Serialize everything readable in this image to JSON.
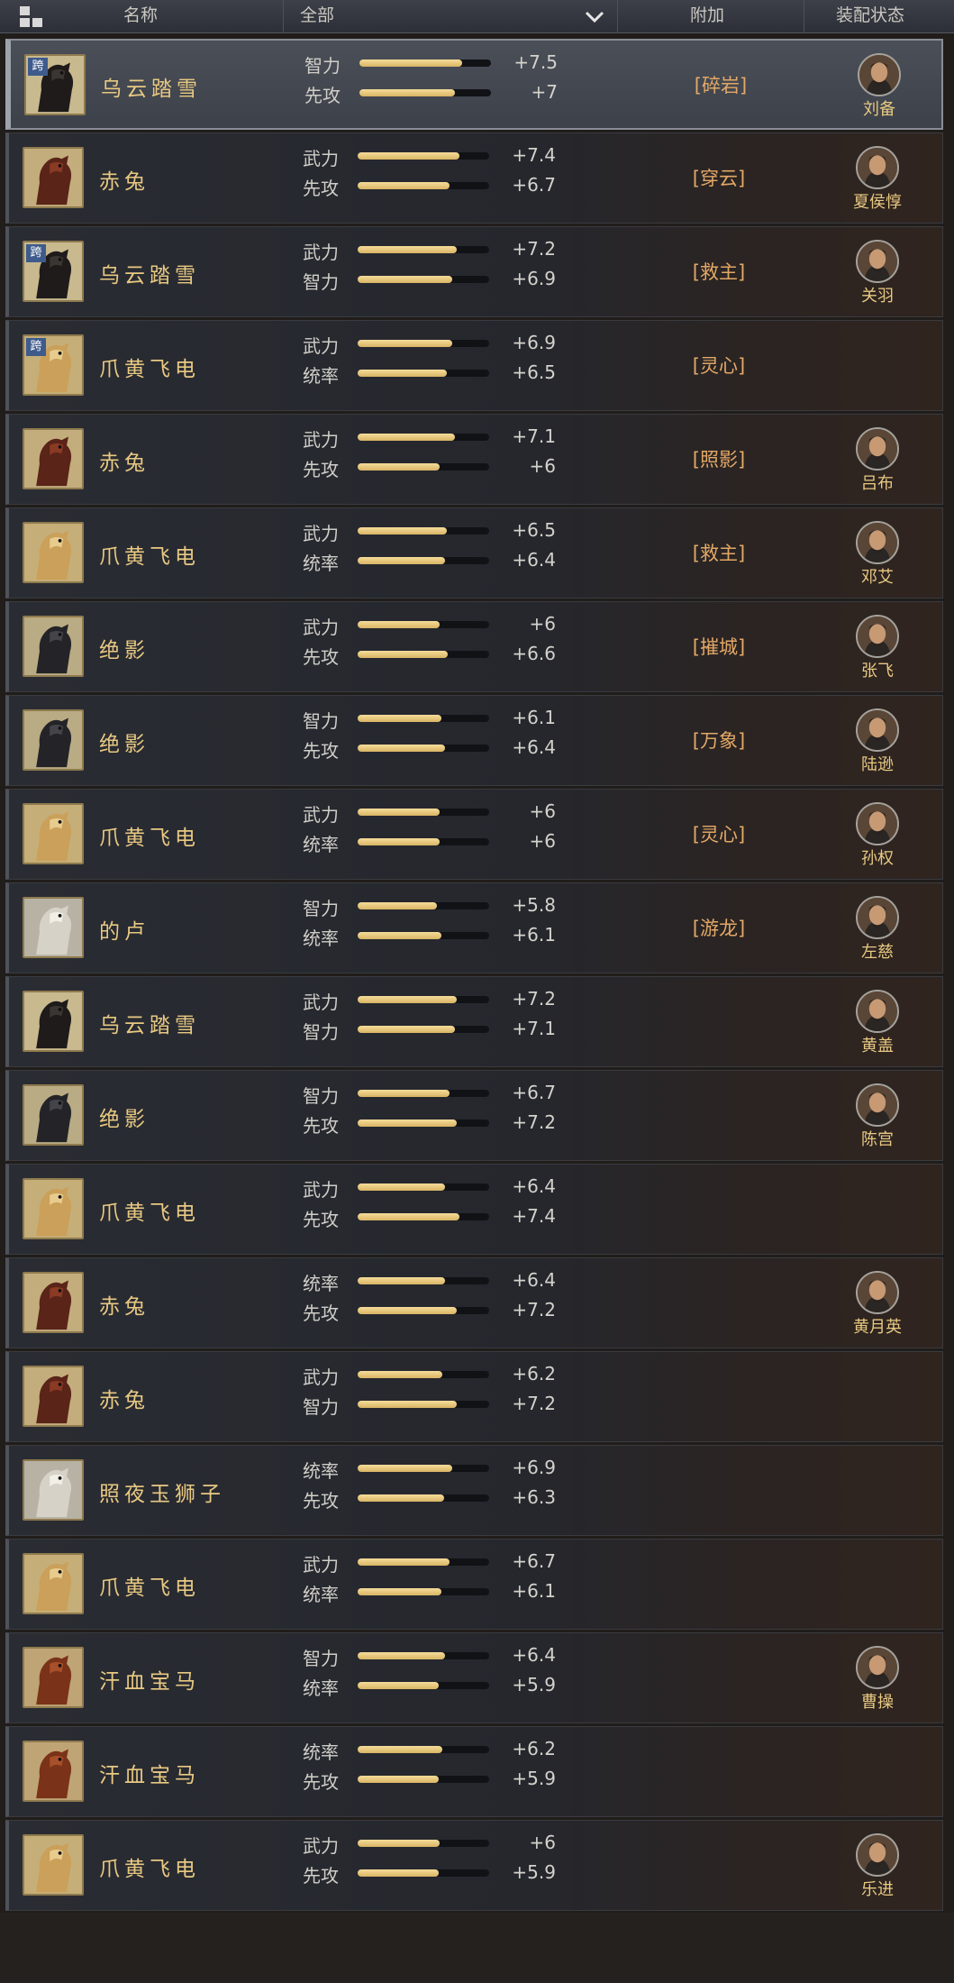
{
  "header": {
    "name_col": "名称",
    "filter": "全部",
    "bonus_col": "附加",
    "equip_col": "装配状态",
    "icons": [
      "grid-icon",
      "chevron-down-icon"
    ]
  },
  "colors": {
    "accent_gold": "#e8c982",
    "bonus_orange": "#e3a866",
    "bar_fill": "#f2d590",
    "cross_badge": "#3e5b8c"
  },
  "horses": [
    {
      "name": "乌云踏雪",
      "kua": "跨",
      "kind": "black",
      "stats": [
        {
          "label": "智力",
          "value": "+7.5"
        },
        {
          "label": "先攻",
          "value": "+7"
        }
      ],
      "bonus": "[碎岩]",
      "general": "刘备"
    },
    {
      "name": "赤兔",
      "kind": "red",
      "stats": [
        {
          "label": "武力",
          "value": "+7.4"
        },
        {
          "label": "先攻",
          "value": "+6.7"
        }
      ],
      "bonus": "[穿云]",
      "general": "夏侯惇"
    },
    {
      "name": "乌云踏雪",
      "kua": "跨",
      "kind": "black",
      "stats": [
        {
          "label": "武力",
          "value": "+7.2"
        },
        {
          "label": "智力",
          "value": "+6.9"
        }
      ],
      "bonus": "[救主]",
      "general": "关羽"
    },
    {
      "name": "爪黄飞电",
      "kua": "跨",
      "kind": "yellow",
      "stats": [
        {
          "label": "武力",
          "value": "+6.9"
        },
        {
          "label": "统率",
          "value": "+6.5"
        }
      ],
      "bonus": "[灵心]",
      "general": ""
    },
    {
      "name": "赤兔",
      "kind": "red",
      "stats": [
        {
          "label": "武力",
          "value": "+7.1"
        },
        {
          "label": "先攻",
          "value": "+6"
        }
      ],
      "bonus": "[照影]",
      "general": "吕布"
    },
    {
      "name": "爪黄飞电",
      "kind": "yellow",
      "stats": [
        {
          "label": "武力",
          "value": "+6.5"
        },
        {
          "label": "统率",
          "value": "+6.4"
        }
      ],
      "bonus": "[救主]",
      "general": "邓艾"
    },
    {
      "name": "绝影",
      "kind": "dark",
      "stats": [
        {
          "label": "武力",
          "value": "+6"
        },
        {
          "label": "先攻",
          "value": "+6.6"
        }
      ],
      "bonus": "[摧城]",
      "general": "张飞"
    },
    {
      "name": "绝影",
      "kind": "dark",
      "stats": [
        {
          "label": "智力",
          "value": "+6.1"
        },
        {
          "label": "先攻",
          "value": "+6.4"
        }
      ],
      "bonus": "[万象]",
      "general": "陆逊"
    },
    {
      "name": "爪黄飞电",
      "kind": "yellow",
      "stats": [
        {
          "label": "武力",
          "value": "+6"
        },
        {
          "label": "统率",
          "value": "+6"
        }
      ],
      "bonus": "[灵心]",
      "general": "孙权"
    },
    {
      "name": "的卢",
      "kind": "white",
      "stats": [
        {
          "label": "智力",
          "value": "+5.8"
        },
        {
          "label": "统率",
          "value": "+6.1"
        }
      ],
      "bonus": "[游龙]",
      "general": "左慈"
    },
    {
      "name": "乌云踏雪",
      "kind": "black",
      "stats": [
        {
          "label": "武力",
          "value": "+7.2"
        },
        {
          "label": "智力",
          "value": "+7.1"
        }
      ],
      "bonus": "",
      "general": "黄盖"
    },
    {
      "name": "绝影",
      "kind": "dark",
      "stats": [
        {
          "label": "智力",
          "value": "+6.7"
        },
        {
          "label": "先攻",
          "value": "+7.2"
        }
      ],
      "bonus": "",
      "general": "陈宫"
    },
    {
      "name": "爪黄飞电",
      "kind": "yellow",
      "stats": [
        {
          "label": "武力",
          "value": "+6.4"
        },
        {
          "label": "先攻",
          "value": "+7.4"
        }
      ],
      "bonus": "",
      "general": ""
    },
    {
      "name": "赤兔",
      "kind": "red",
      "stats": [
        {
          "label": "统率",
          "value": "+6.4"
        },
        {
          "label": "先攻",
          "value": "+7.2"
        }
      ],
      "bonus": "",
      "general": "黄月英"
    },
    {
      "name": "赤兔",
      "kind": "red",
      "stats": [
        {
          "label": "武力",
          "value": "+6.2"
        },
        {
          "label": "智力",
          "value": "+7.2"
        }
      ],
      "bonus": "",
      "general": ""
    },
    {
      "name": "照夜玉狮子",
      "kind": "white",
      "stats": [
        {
          "label": "统率",
          "value": "+6.9"
        },
        {
          "label": "先攻",
          "value": "+6.3"
        }
      ],
      "bonus": "",
      "general": ""
    },
    {
      "name": "爪黄飞电",
      "kind": "yellow",
      "stats": [
        {
          "label": "武力",
          "value": "+6.7"
        },
        {
          "label": "统率",
          "value": "+6.1"
        }
      ],
      "bonus": "",
      "general": ""
    },
    {
      "name": "汗血宝马",
      "kind": "brown",
      "stats": [
        {
          "label": "智力",
          "value": "+6.4"
        },
        {
          "label": "统率",
          "value": "+5.9"
        }
      ],
      "bonus": "",
      "general": "曹操"
    },
    {
      "name": "汗血宝马",
      "kind": "brown",
      "stats": [
        {
          "label": "统率",
          "value": "+6.2"
        },
        {
          "label": "先攻",
          "value": "+5.9"
        }
      ],
      "bonus": "",
      "general": ""
    },
    {
      "name": "爪黄飞电",
      "kind": "yellow",
      "stats": [
        {
          "label": "武力",
          "value": "+6"
        },
        {
          "label": "先攻",
          "value": "+5.9"
        }
      ],
      "bonus": "",
      "general": "乐进"
    }
  ]
}
